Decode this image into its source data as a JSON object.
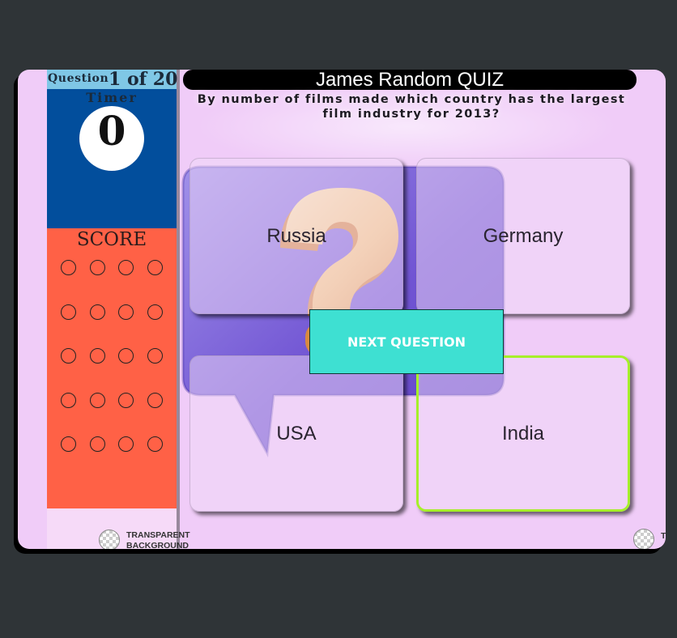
{
  "header": {
    "title": "James Random QUIZ"
  },
  "question": {
    "text": "By number of films made which country has the largest film industry for 2013?"
  },
  "counter": {
    "label": "Question",
    "value": "1 of 20"
  },
  "timer": {
    "label": "Timer",
    "value": "0"
  },
  "score": {
    "label": "SCORE",
    "slots_filled": 0,
    "slots_total": 20
  },
  "answers": [
    {
      "label": "Russia"
    },
    {
      "label": "Germany"
    },
    {
      "label": "USA"
    },
    {
      "label": "India",
      "highlighted": true
    }
  ],
  "next_button": {
    "label": "NEXT QUESTION"
  },
  "watermark": {
    "text_line1": "TRANSPARENT",
    "text_line2": "BACKGROUND",
    "partial_right": "T"
  },
  "colors": {
    "timer_panel": "#024e9c",
    "score_panel": "#ff6146",
    "counter_bar": "#7fc7e6",
    "next_button": "#3ee0d2",
    "highlight_border": "#a6ef2a",
    "background": "#f0ccf8"
  },
  "icons": {
    "hero": "question-mark-speech-bubble-icon",
    "watermark": "transparency-checker-icon"
  }
}
